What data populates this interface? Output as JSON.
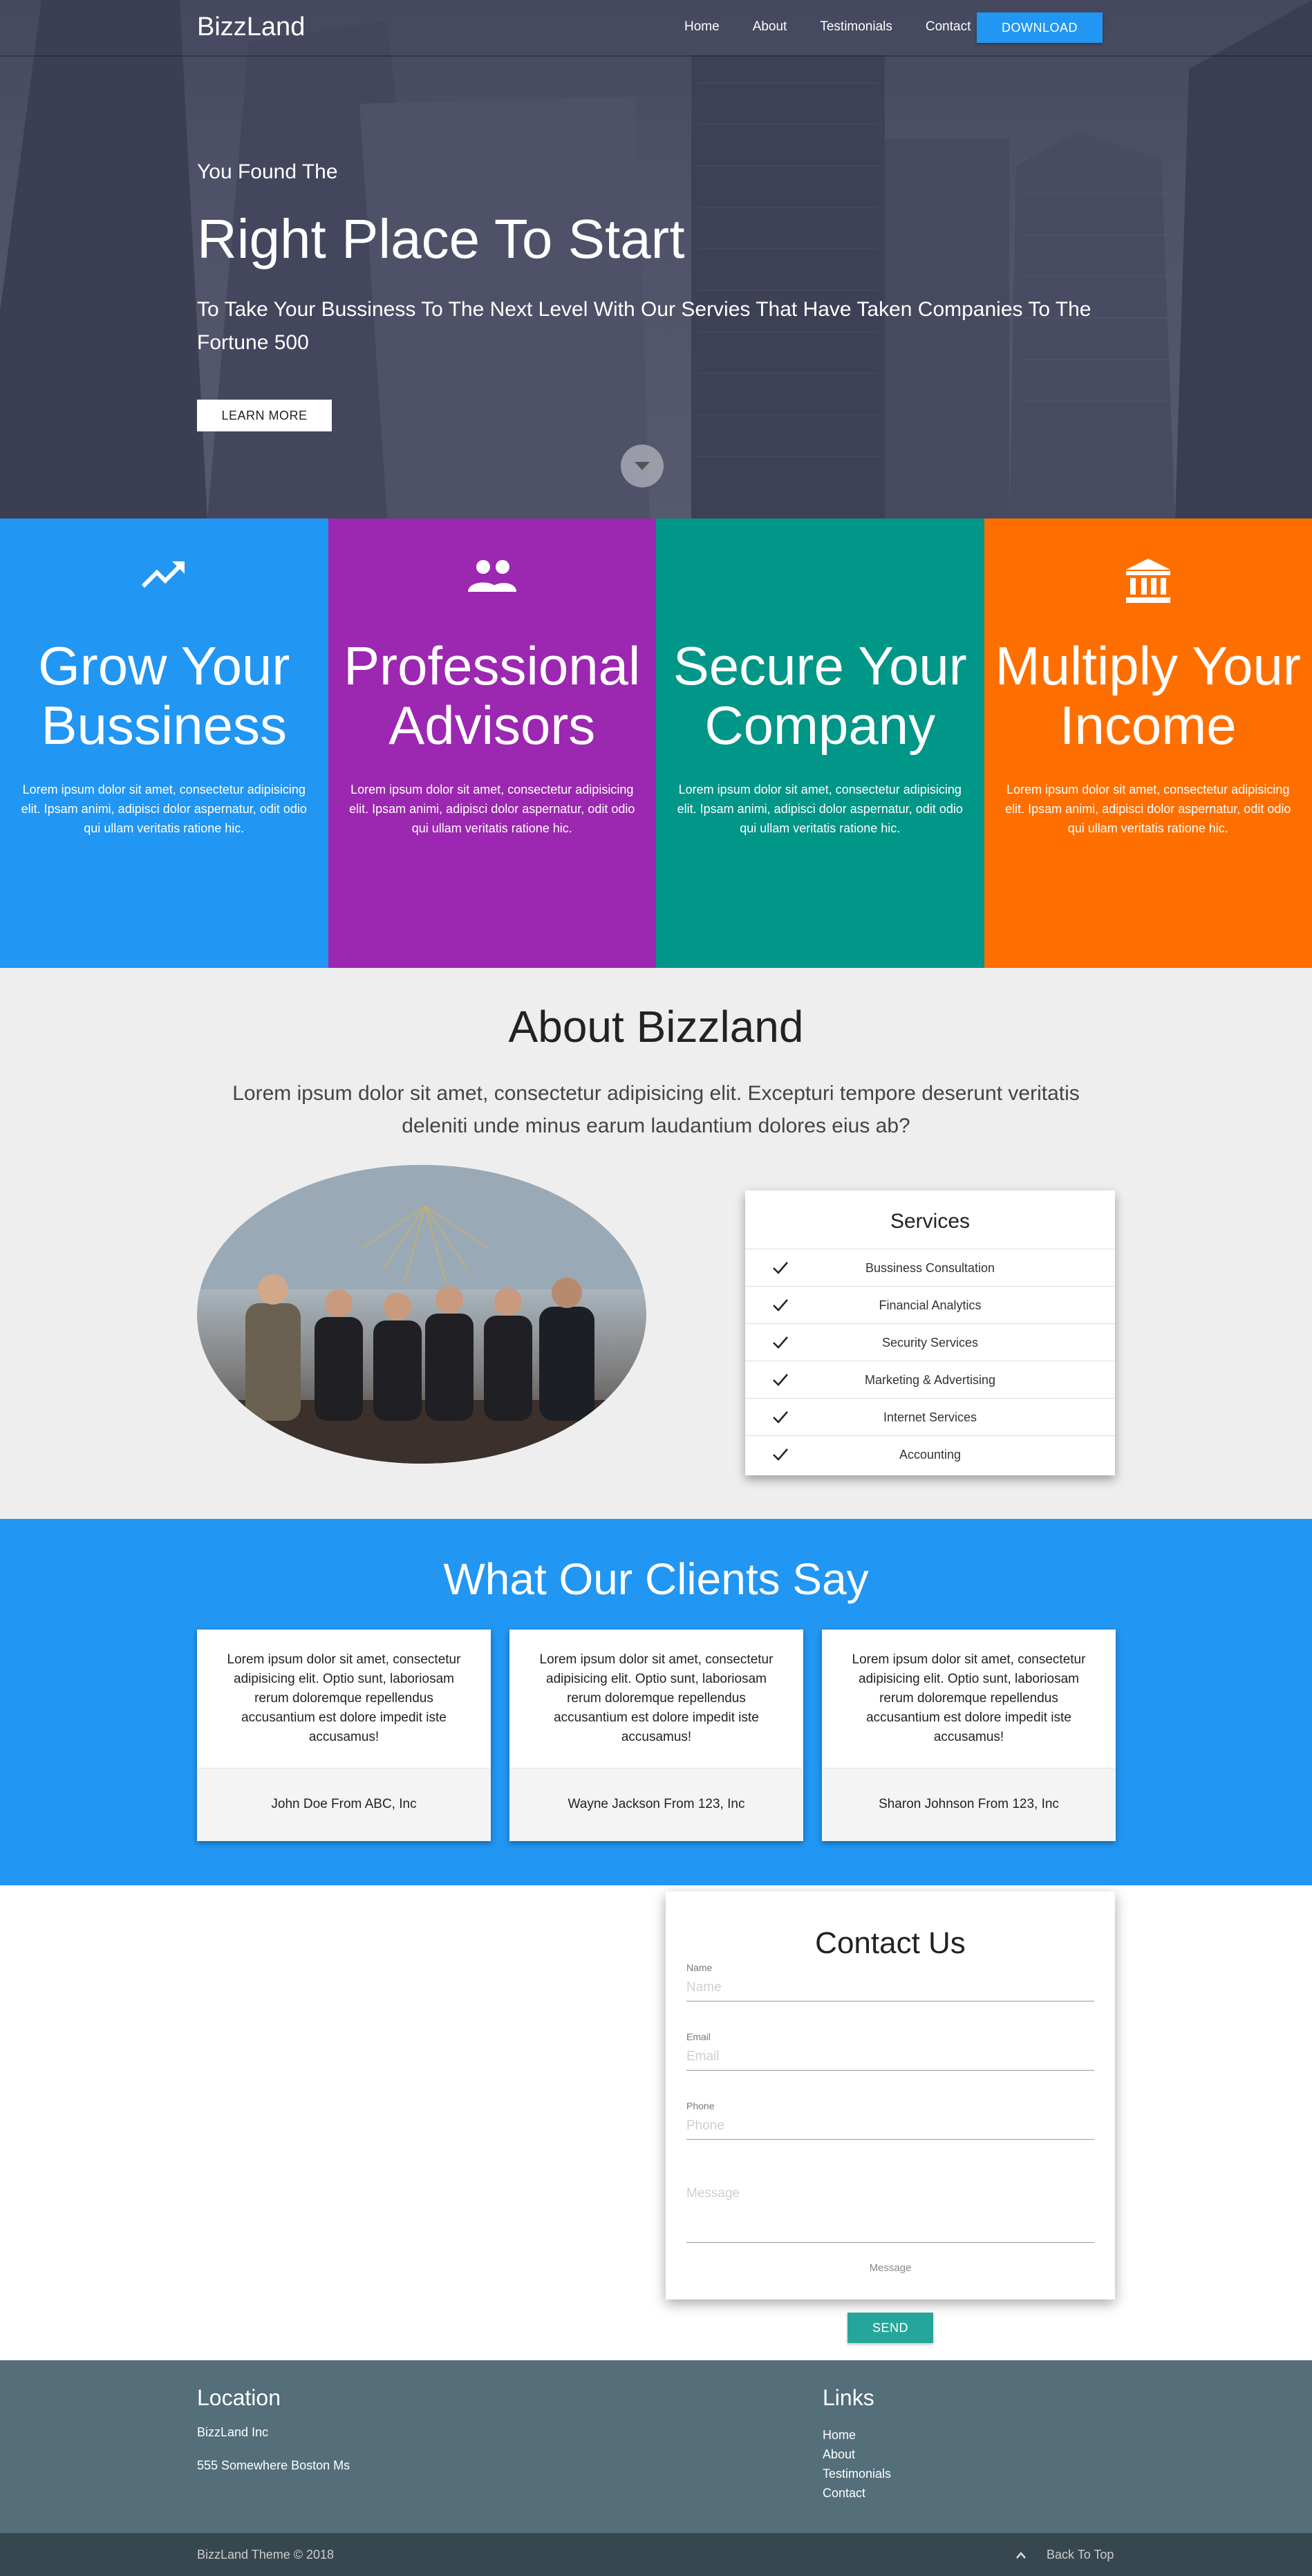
{
  "brand": "BizzLand",
  "nav": {
    "links": [
      "Home",
      "About",
      "Testimonials",
      "Contact"
    ],
    "download_label": "DOWNLOAD"
  },
  "hero": {
    "kicker": "You Found The",
    "headline": "Right Place To Start",
    "subtitle": "To Take Your Bussiness To The Next Level With Our Servies That Have Taken Companies To The Fortune 500",
    "cta_label": "LEARN MORE",
    "scroll_icon": "chevron-down-icon"
  },
  "features": [
    {
      "icon": "trending-up-icon",
      "title": "Grow Your Bussiness",
      "text": "Lorem ipsum dolor sit amet, consectetur adipisicing elit. Ipsam animi, adipisci dolor aspernatur, odit odio qui ullam veritatis ratione hic.",
      "color": "#2196f3"
    },
    {
      "icon": "people-icon",
      "title": "Professional Advisors",
      "text": "Lorem ipsum dolor sit amet, consectetur adipisicing elit. Ipsam animi, adipisci dolor aspernatur, odit odio qui ullam veritatis ratione hic.",
      "color": "#9c27b0"
    },
    {
      "icon": "shield-lock-icon",
      "title": "Secure Your Company",
      "text": "Lorem ipsum dolor sit amet, consectetur adipisicing elit. Ipsam animi, adipisci dolor aspernatur, odit odio qui ullam veritatis ratione hic.",
      "color": "#009688"
    },
    {
      "icon": "bank-icon",
      "title": "Multiply Your Income",
      "text": "Lorem ipsum dolor sit amet, consectetur adipisicing elit. Ipsam animi, adipisci dolor aspernatur, odit odio qui ullam veritatis ratione hic.",
      "color": "#ff6f00"
    }
  ],
  "about": {
    "title": "About Bizzland",
    "lead": "Lorem ipsum dolor sit amet, consectetur adipisicing elit. Excepturi tempore deserunt veritatis deleniti unde minus earum laudantium dolores eius ab?",
    "services_title": "Services",
    "services": [
      "Bussiness Consultation",
      "Financial Analytics",
      "Security Services",
      "Marketing & Advertising",
      "Internet Services",
      "Accounting"
    ]
  },
  "testimonials": {
    "title": "What Our Clients Say",
    "items": [
      {
        "quote": "Lorem ipsum dolor sit amet, consectetur adipisicing elit. Optio sunt, laboriosam rerum doloremque repellendus accusantium est dolore impedit iste accusamus!",
        "author": "John Doe From ABC, Inc"
      },
      {
        "quote": "Lorem ipsum dolor sit amet, consectetur adipisicing elit. Optio sunt, laboriosam rerum doloremque repellendus accusantium est dolore impedit iste accusamus!",
        "author": "Wayne Jackson From 123, Inc"
      },
      {
        "quote": "Lorem ipsum dolor sit amet, consectetur adipisicing elit. Optio sunt, laboriosam rerum doloremque repellendus accusantium est dolore impedit iste accusamus!",
        "author": "Sharon Johnson From 123, Inc"
      }
    ]
  },
  "contact": {
    "title": "Contact Us",
    "fields": [
      {
        "label": "Name",
        "placeholder": "Name",
        "value": ""
      },
      {
        "label": "Email",
        "placeholder": "Email",
        "value": ""
      },
      {
        "label": "Phone",
        "placeholder": "Phone",
        "value": ""
      }
    ],
    "message_placeholder": "Message",
    "message_caption": "Message",
    "send_label": "SEND"
  },
  "footer": {
    "location_title": "Location",
    "company": "BizzLand Inc",
    "address": "555 Somewhere Boston Ms",
    "links_title": "Links",
    "links": [
      "Home",
      "About",
      "Testimonials",
      "Contact"
    ],
    "copyright": "BizzLand Theme © 2018",
    "back_to_top": "Back To Top"
  },
  "colors": {
    "primary": "#2196f3",
    "purple": "#9c27b0",
    "teal": "#009688",
    "orange": "#ff6f00",
    "send": "#26a69a",
    "footer": "#546e7a",
    "footer_bar": "#37474f"
  }
}
